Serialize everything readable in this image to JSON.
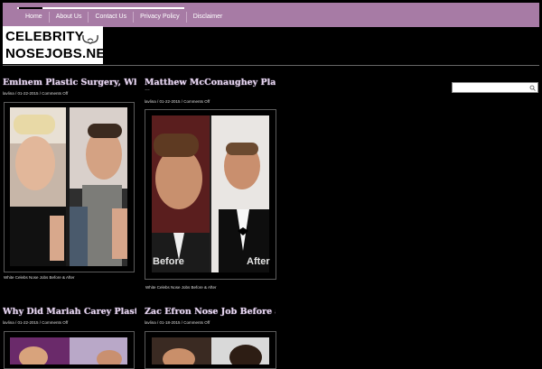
{
  "nav": {
    "items": [
      "Home",
      "About Us",
      "Contact Us",
      "Privacy Policy",
      "Disclaimer"
    ]
  },
  "logo": {
    "line1": "CELEBRITY",
    "line2": "NOSEJOBS.NET",
    "icon": "nose-icon"
  },
  "search": {
    "value": "",
    "icon": "search-icon"
  },
  "posts": [
    {
      "title": "Eminem Plastic Surgery, What…",
      "meta": "lavlina / 01-22-2015 / Comments Off",
      "caption": "White Celebs Nose Jobs Before & After",
      "continuation": ""
    },
    {
      "title": "Matthew McConaughey Plastic",
      "meta": "lavlina / 01-22-2015 / Comments Off",
      "caption": "White Celebs Nose Jobs Before & After",
      "continuation": "…",
      "photo_labels": [
        "Before",
        "After"
      ]
    },
    {
      "title": "Why Did Mariah Carey Plastic…",
      "meta": "lavlina / 01-22-2015 / Comments Off",
      "caption": "",
      "continuation": ""
    },
    {
      "title": "Zac Efron Nose Job Before an…",
      "meta": "lavlina / 01-18-2015 / Comments Off",
      "caption": "",
      "continuation": ""
    }
  ],
  "colors": {
    "nav_bg": "#a77ba5",
    "title": "#e7d7f0",
    "page_bg": "#000000"
  }
}
